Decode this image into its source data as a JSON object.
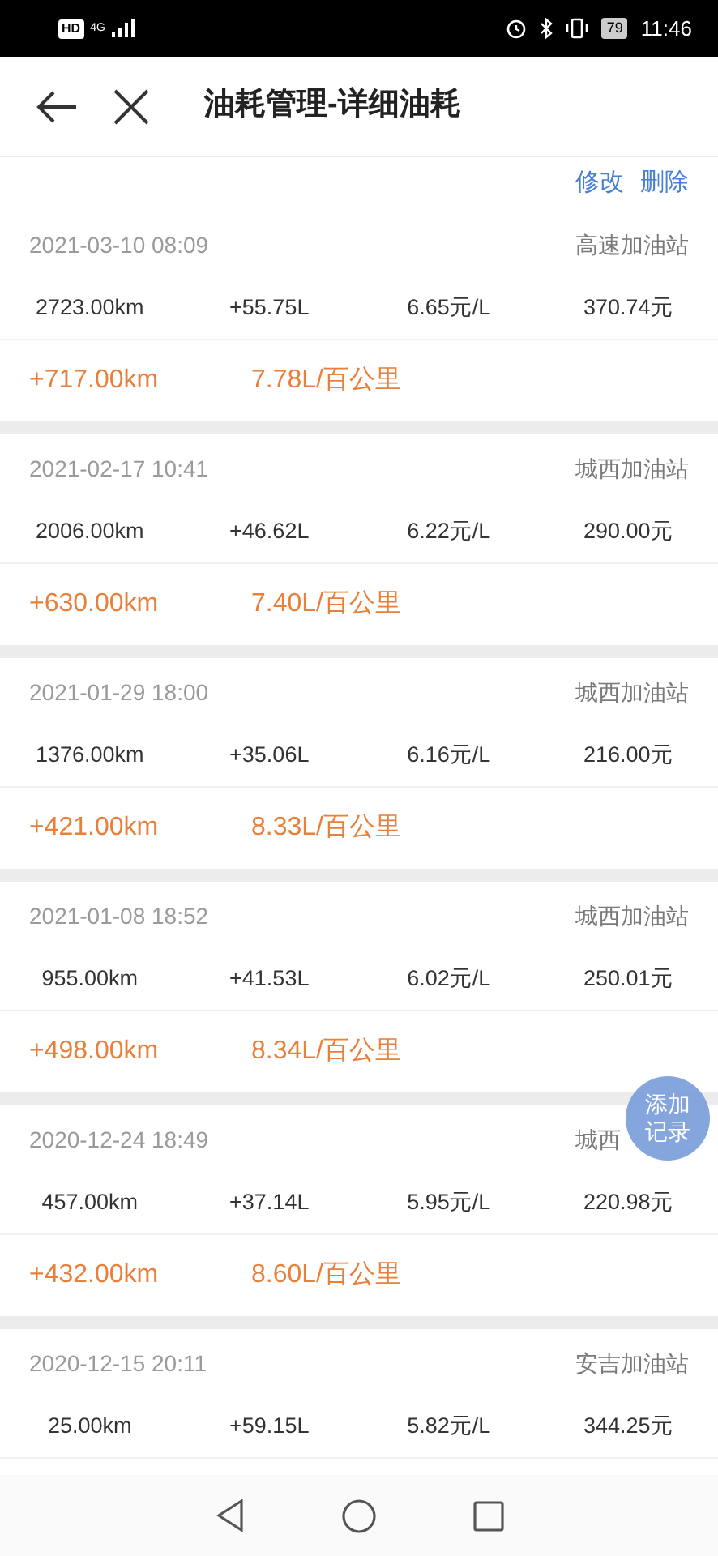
{
  "status_bar": {
    "hd": "HD",
    "network": "4G",
    "battery": "79",
    "time": "11:46"
  },
  "header": {
    "title": "油耗管理-详细油耗"
  },
  "actions": [
    "修改",
    "删除"
  ],
  "records": [
    {
      "datetime": "2021-03-10 08:09",
      "station": "高速加油站",
      "odometer": "2723.00km",
      "fuel": "+55.75L",
      "price": "6.65元/L",
      "cost": "370.74元",
      "distance": "+717.00km",
      "consumption": "7.78L/百公里"
    },
    {
      "datetime": "2021-02-17 10:41",
      "station": "城西加油站",
      "odometer": "2006.00km",
      "fuel": "+46.62L",
      "price": "6.22元/L",
      "cost": "290.00元",
      "distance": "+630.00km",
      "consumption": "7.40L/百公里"
    },
    {
      "datetime": "2021-01-29 18:00",
      "station": "城西加油站",
      "odometer": "1376.00km",
      "fuel": "+35.06L",
      "price": "6.16元/L",
      "cost": "216.00元",
      "distance": "+421.00km",
      "consumption": "8.33L/百公里"
    },
    {
      "datetime": "2021-01-08 18:52",
      "station": "城西加油站",
      "odometer": "955.00km",
      "fuel": "+41.53L",
      "price": "6.02元/L",
      "cost": "250.01元",
      "distance": "+498.00km",
      "consumption": "8.34L/百公里"
    },
    {
      "datetime": "2020-12-24 18:49",
      "station": "城西",
      "odometer": "457.00km",
      "fuel": "+37.14L",
      "price": "5.95元/L",
      "cost": "220.98元",
      "distance": "+432.00km",
      "consumption": "8.60L/百公里"
    },
    {
      "datetime": "2020-12-15 20:11",
      "station": "安吉加油站",
      "odometer": "25.00km",
      "fuel": "+59.15L",
      "price": "5.82元/L",
      "cost": "344.25元"
    }
  ],
  "fab": {
    "label": "添加记录"
  }
}
